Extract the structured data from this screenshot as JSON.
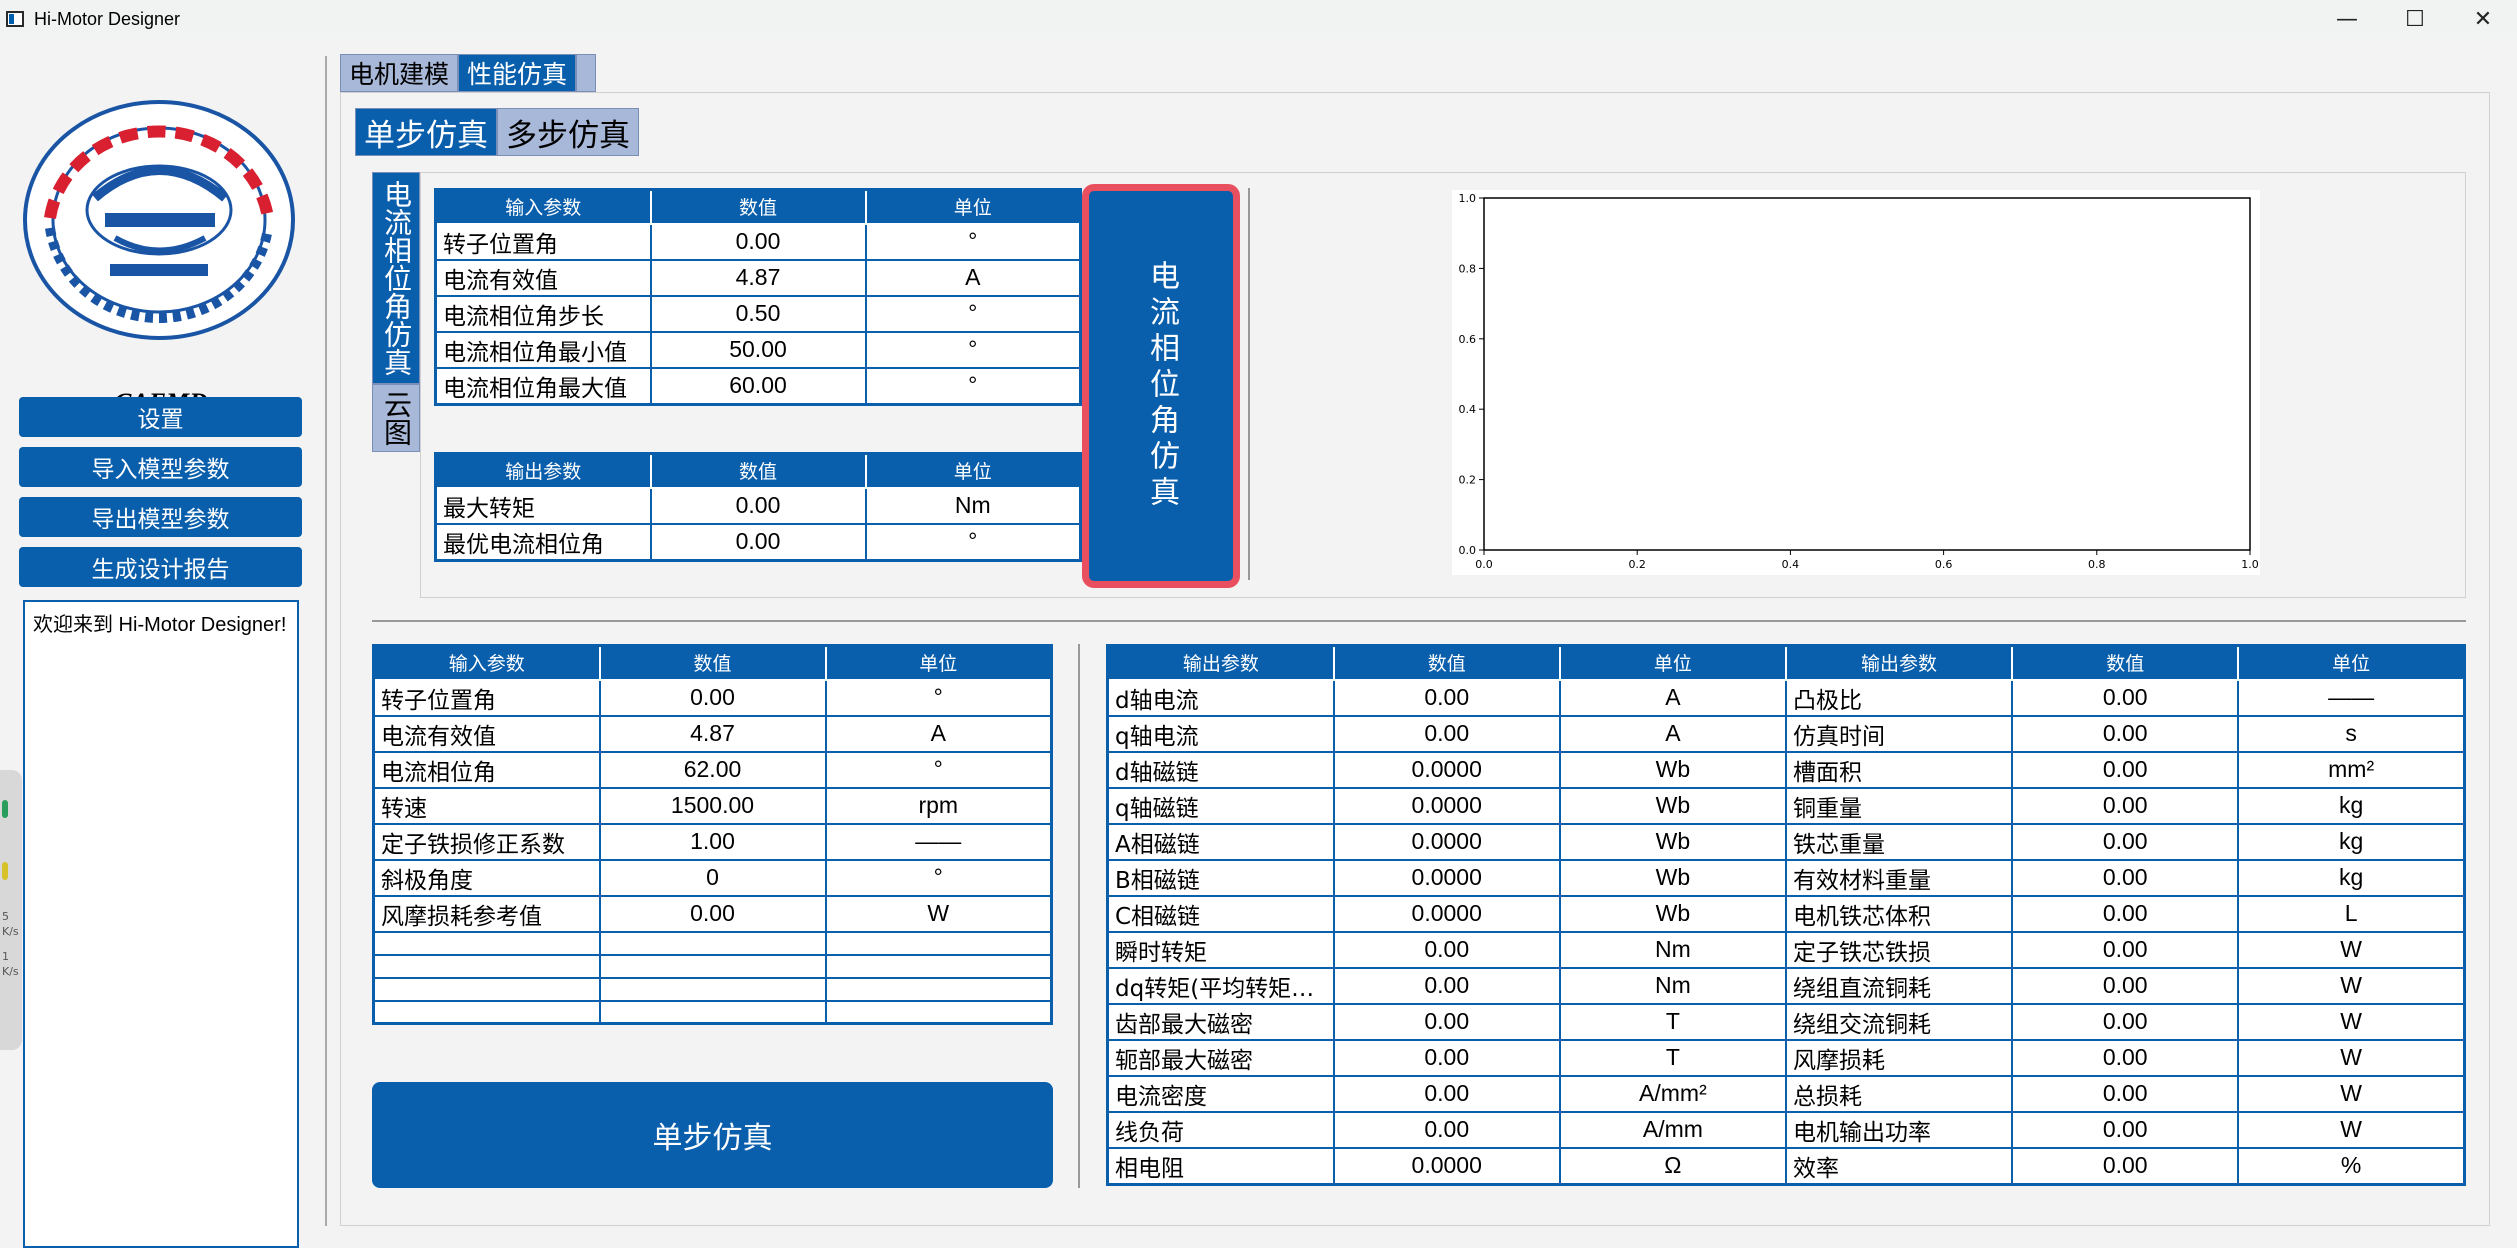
{
  "window": {
    "title": "Hi-Motor Designer",
    "minimize": "—",
    "maximize": "☐",
    "close": "✕"
  },
  "sidebar": {
    "app_name": "CAEMD",
    "buttons": [
      "设置",
      "导入模型参数",
      "导出模型参数",
      "生成设计报告"
    ],
    "welcome": "欢迎来到 Hi-Motor Designer!"
  },
  "edge_widget": {
    "lines": [
      "5",
      "K/s",
      "1",
      "K/s"
    ]
  },
  "main_tabs": [
    "电机建模",
    "性能仿真"
  ],
  "sub_tabs": [
    "单步仿真",
    "多步仿真"
  ],
  "side_tabs": [
    "电流相位角仿真",
    "云图"
  ],
  "phase_sim": {
    "input_headers": [
      "输入参数",
      "数值",
      "单位"
    ],
    "input_rows": [
      [
        "转子位置角",
        "0.00",
        "°"
      ],
      [
        "电流有效值",
        "4.87",
        "A"
      ],
      [
        "电流相位角步长",
        "0.50",
        "°"
      ],
      [
        "电流相位角最小值",
        "50.00",
        "°"
      ],
      [
        "电流相位角最大值",
        "60.00",
        "°"
      ]
    ],
    "output_headers": [
      "输出参数",
      "数值",
      "单位"
    ],
    "output_rows": [
      [
        "最大转矩",
        "0.00",
        "Nm"
      ],
      [
        "最优电流相位角",
        "0.00",
        "°"
      ]
    ],
    "button": "电流相位角仿真"
  },
  "chart_data": {
    "type": "line",
    "title": "",
    "xlabel": "",
    "ylabel": "",
    "xlim": [
      0,
      1
    ],
    "ylim": [
      0,
      1
    ],
    "xticks": [
      "0.0",
      "0.2",
      "0.4",
      "0.6",
      "0.8",
      "1.0"
    ],
    "yticks": [
      "0.0",
      "0.2",
      "0.4",
      "0.6",
      "0.8",
      "1.0"
    ],
    "series": []
  },
  "step_sim": {
    "input_headers": [
      "输入参数",
      "数值",
      "单位"
    ],
    "input_rows": [
      [
        "转子位置角",
        "0.00",
        "°"
      ],
      [
        "电流有效值",
        "4.87",
        "A"
      ],
      [
        "电流相位角",
        "62.00",
        "°"
      ],
      [
        "转速",
        "1500.00",
        "rpm"
      ],
      [
        "定子铁损修正系数",
        "1.00",
        "——"
      ],
      [
        "斜极角度",
        "0",
        "°"
      ],
      [
        "风摩损耗参考值",
        "0.00",
        "W"
      ],
      [
        "",
        "",
        ""
      ],
      [
        "",
        "",
        ""
      ],
      [
        "",
        "",
        ""
      ],
      [
        "",
        "",
        ""
      ]
    ],
    "button": "单步仿真",
    "output_headers": [
      "输出参数",
      "数值",
      "单位",
      "输出参数",
      "数值",
      "单位"
    ],
    "output_rows": [
      [
        "d轴电流",
        "0.00",
        "A",
        "凸极比",
        "0.00",
        "——"
      ],
      [
        "q轴电流",
        "0.00",
        "A",
        "仿真时间",
        "0.00",
        "s"
      ],
      [
        "d轴磁链",
        "0.0000",
        "Wb",
        "槽面积",
        "0.00",
        "mm²"
      ],
      [
        "q轴磁链",
        "0.0000",
        "Wb",
        "铜重量",
        "0.00",
        "kg"
      ],
      [
        "A相磁链",
        "0.0000",
        "Wb",
        "铁芯重量",
        "0.00",
        "kg"
      ],
      [
        "B相磁链",
        "0.0000",
        "Wb",
        "有效材料重量",
        "0.00",
        "kg"
      ],
      [
        "C相磁链",
        "0.0000",
        "Wb",
        "电机铁芯体积",
        "0.00",
        "L"
      ],
      [
        "瞬时转矩",
        "0.00",
        "Nm",
        "定子铁芯铁损",
        "0.00",
        "W"
      ],
      [
        "dq转矩(平均转矩…",
        "0.00",
        "Nm",
        "绕组直流铜耗",
        "0.00",
        "W"
      ],
      [
        "齿部最大磁密",
        "0.00",
        "T",
        "绕组交流铜耗",
        "0.00",
        "W"
      ],
      [
        "轭部最大磁密",
        "0.00",
        "T",
        "风摩损耗",
        "0.00",
        "W"
      ],
      [
        "电流密度",
        "0.00",
        "A/mm²",
        "总损耗",
        "0.00",
        "W"
      ],
      [
        "线负荷",
        "0.00",
        "A/mm",
        "电机输出功率",
        "0.00",
        "W"
      ],
      [
        "相电阻",
        "0.0000",
        "Ω",
        "效率",
        "0.00",
        "%"
      ]
    ]
  },
  "colors": {
    "accent": "#0a5fad",
    "tab_inactive": "#a8b8d8",
    "highlight_border": "#e8505f"
  }
}
